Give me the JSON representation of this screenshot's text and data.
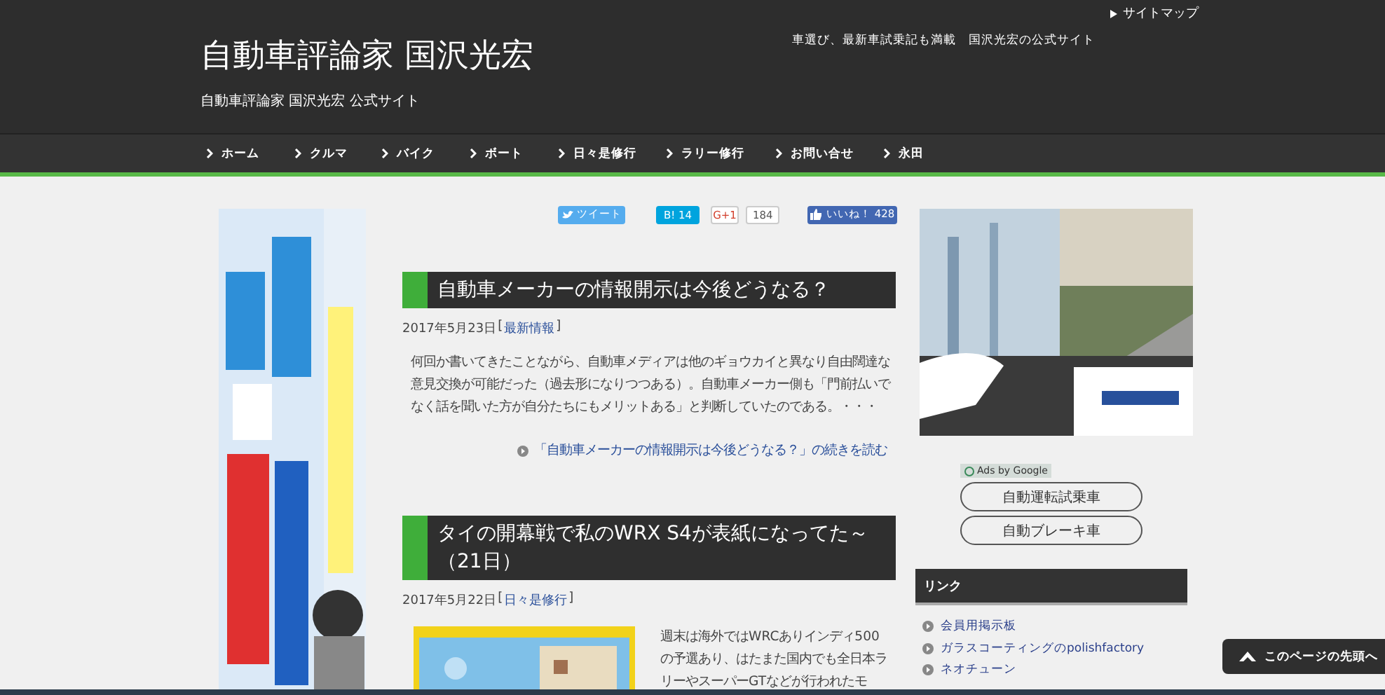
{
  "header": {
    "title": "自動車評論家 国沢光宏",
    "subtitle": "自動車評論家 国沢光宏 公式サイト",
    "tagline": "車選び、最新車試乗記も満載　国沢光宏の公式サイト",
    "sitemap_link": "サイトマップ"
  },
  "nav": [
    {
      "label": "ホーム"
    },
    {
      "label": "クルマ"
    },
    {
      "label": "バイク"
    },
    {
      "label": "ボート"
    },
    {
      "label": "日々是修行"
    },
    {
      "label": "ラリー修行"
    },
    {
      "label": "お問い合せ"
    },
    {
      "label": "永田"
    }
  ],
  "share": [
    {
      "kind": "twitter",
      "label": "ツイート"
    },
    {
      "kind": "hatena",
      "label": "B! 14"
    },
    {
      "kind": "gplus",
      "label": "G+1",
      "count": "184"
    },
    {
      "kind": "facebook",
      "label": "いいね！ 428"
    }
  ],
  "posts": [
    {
      "title": "自動車メーカーの情報開示は今後どうなる？",
      "date": "2017年5月23日",
      "bracket_open": "[",
      "category": "最新情報",
      "bracket_close": "]",
      "excerpt": "何回か書いてきたことながら、自動車メディアは他のギョウカイと異なり自由闊達な意見交換が可能だった（過去形になりつつある）。自動車メーカー側も「門前払いでなく話を聞いた方が自分たちにもメリットある」と判断していたのである。・・・",
      "more": "「自動車メーカーの情報開示は今後どうなる？」の続きを読む",
      "thumbnail": false
    },
    {
      "title": "タイの開幕戦で私のWRX S4が表紙になってた～（21日）",
      "date": "2017年5月22日",
      "bracket_open": "[",
      "category": "日々是修行",
      "bracket_close": "]",
      "excerpt": "週末は海外ではWRCありインディ500の予選あり、はたまた国内でも全日本ラリーやスーパーGTなどが行われたモ",
      "thumbnail": true
    }
  ],
  "sidebar": {
    "ads_label": "Ads by Google",
    "ad_buttons": [
      "自動運転試乗車",
      "自動ブレーキ車"
    ],
    "links_heading": "リンク",
    "links": [
      "会員用掲示板",
      "ガラスコーティングのpolishfactory",
      "ネオチューン"
    ]
  },
  "back_to_top": "このページの先頭へ"
}
